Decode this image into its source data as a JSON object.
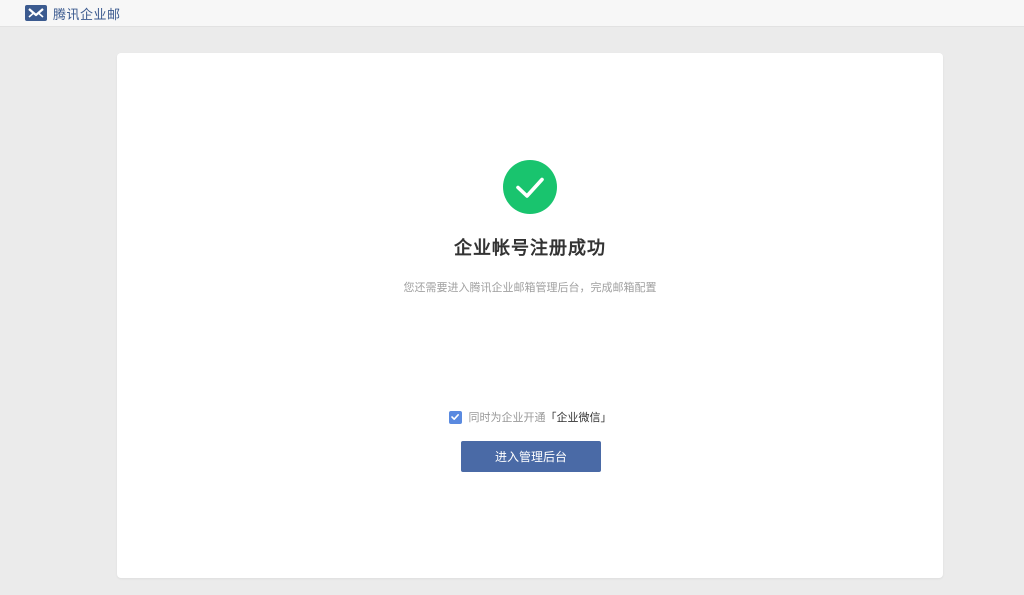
{
  "header": {
    "logo_text": "腾讯企业邮",
    "logo_icon": "tencent-mail-logo-icon",
    "brand_color": "#3b5a8f"
  },
  "result": {
    "icon": "check-circle-icon",
    "icon_color": "#19c46e",
    "title": "企业帐号注册成功",
    "subtitle": "您还需要进入腾讯企业邮箱管理后台，完成邮箱配置"
  },
  "options": {
    "wework_checked": true,
    "wework_label_prefix": "同时为企业开通",
    "wework_label_highlight": "「企业微信」",
    "checkbox_color": "#5a8ae0"
  },
  "actions": {
    "enter_admin_label": "进入管理后台",
    "button_color": "#4a6aa6"
  }
}
